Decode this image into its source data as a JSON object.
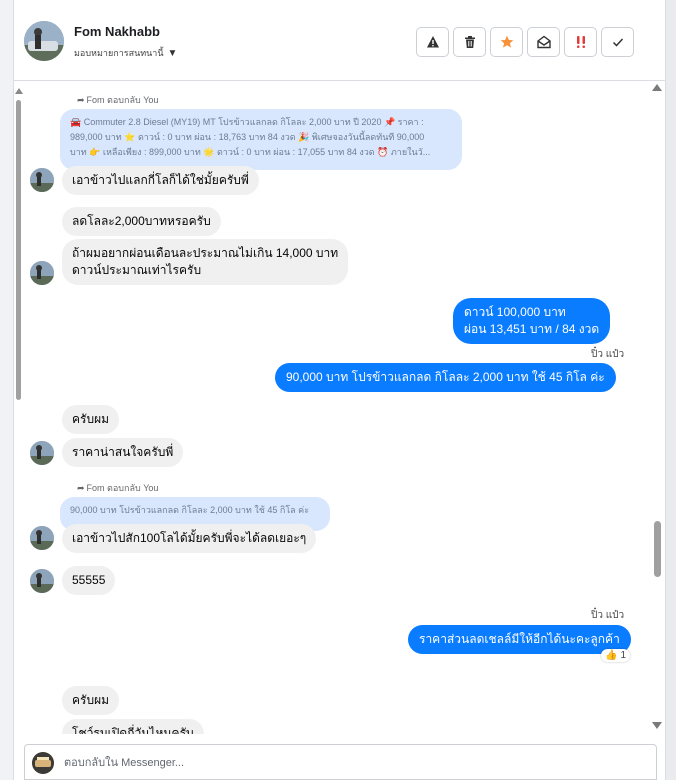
{
  "header": {
    "contact_name": "Fom Nakhabb",
    "assign_label": "มอบหมายการสนทนานี้"
  },
  "actions": [
    {
      "name": "report-button",
      "icon": "warning-icon"
    },
    {
      "name": "delete-button",
      "icon": "trash-icon"
    },
    {
      "name": "star-button",
      "icon": "star-icon",
      "color": "#f7923b"
    },
    {
      "name": "mark-unread-button",
      "icon": "envelope-open-icon"
    },
    {
      "name": "spam-button",
      "icon": "double-exclamation-icon",
      "color": "#e03c3c"
    },
    {
      "name": "mark-done-button",
      "icon": "checkmark-icon"
    }
  ],
  "colors": {
    "outgoing_bubble": "#0a7cff",
    "incoming_bubble": "#f0f0f0",
    "quote_bubble": "#d8e7fd"
  },
  "messages": {
    "reply_label_1": "Fom ตอบกลับ You",
    "quote_1_line1": "🚘 Commuter 2.8 Diesel (MY19) MT โปรข้าวแลกลด กิโลละ 2,000 บาท ปี 2020 📌 ราคา :",
    "quote_1_line2": "989,000 บาท ⭐ ดาวน์ : 0 บาท ผ่อน : 18,763 บาท 84 งวด 🎉 พิเศษจองวันนี้ลดทันที 90,000",
    "quote_1_line3": "บาท 👉 เหลือเพียง : 899,000 บาท 🌟 ดาวน์ : 0 บาท ผ่อน : 17,055 บาท 84 งวด ⏰ ภายในวั...",
    "m1": "เอาข้าวไปแลกกี่โลก็ได้ใช่มั้ยครับพี่",
    "m2": "ลดโลละ2,000บาทหรอครับ",
    "m3_line1": "ถ้าผมอยากผ่อนเดือนละประมาณไม่เกิน 14,000 บาท",
    "m3_line2": "ดาวน์ประมาณเท่าไรครับ",
    "out1_line1": "ดาวน์ 100,000 บาท",
    "out1_line2": "ผ่อน   13,451 บาท   / 84 งวด",
    "sender_1": "ปิ๋ว แป๋ว",
    "out2": "90,000 บาท  โปรข้าวแลกลด กิโลละ 2,000 บาท   ใช้ 45 กิโล ค่ะ",
    "m4": "ครับผม",
    "m5": "ราคาน่าสนใจครับพี่",
    "reply_label_2": "Fom ตอบกลับ You",
    "quote_2": "90,000 บาท โปรข้าวแลกลด กิโลละ 2,000 บาท ใช้ 45 กิโล ค่ะ",
    "m6": "เอาข้าวไปสัก100โลได้มั้ยครับพี่จะได้ลดเยอะๆ",
    "m7": "55555",
    "sender_2": "ปิ๋ว แป๋ว",
    "out3": "ราคาส่วนลดเชลล์มีให้อีกได้นะคะลูกค้า",
    "reaction_emoji": "👍",
    "reaction_count": "1",
    "m8": "ครับผม",
    "m9": "โชว์รูมเปิดกี่วันไหนครับ"
  },
  "composer": {
    "placeholder": "ตอบกลับใน Messenger..."
  }
}
